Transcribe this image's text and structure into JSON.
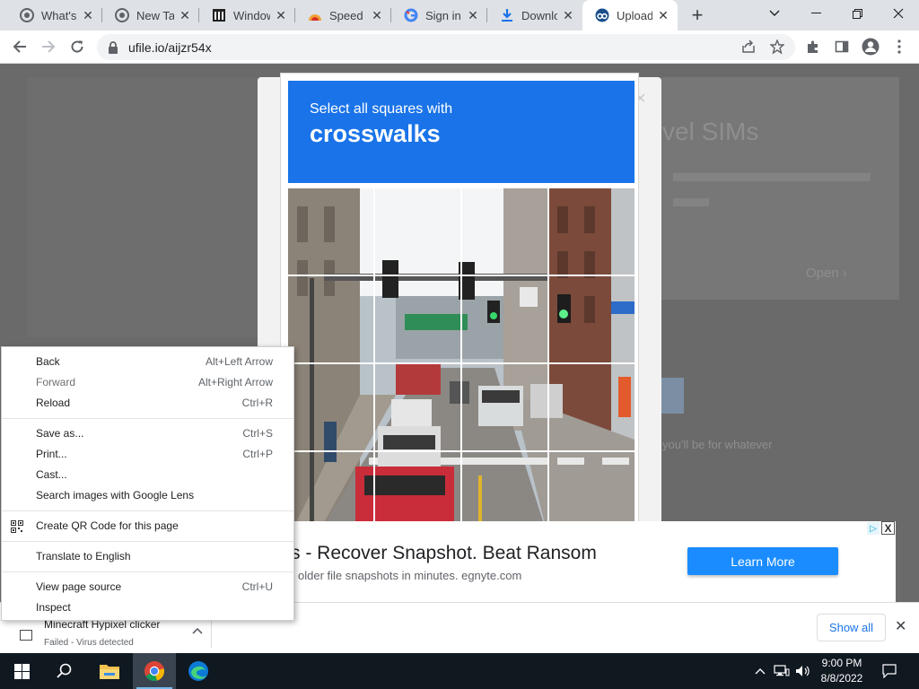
{
  "browser": {
    "tabs": [
      {
        "title": "What's N",
        "icon": "chrome-icon"
      },
      {
        "title": "New Tab",
        "icon": "chrome-icon"
      },
      {
        "title": "Windows",
        "icon": "building-icon"
      },
      {
        "title": "Speed D",
        "icon": "speed-icon"
      },
      {
        "title": "Sign in",
        "icon": "google-icon"
      },
      {
        "title": "Downlo",
        "icon": "download-icon"
      },
      {
        "title": "Upload",
        "icon": "ufile-icon",
        "active": true
      }
    ],
    "url": "ufile.io/aijzr54x"
  },
  "background": {
    "heading_fragment": "vel SIMs",
    "cta_fragment": "Open",
    "footer_fragment": "you'll be for whatever"
  },
  "captcha": {
    "instruction": "Select all squares with",
    "target": "crosswalks",
    "close": "×"
  },
  "ad": {
    "title": "s - Recover Snapshot. Beat Ransom",
    "subtitle": "older file snapshots in minutes. egnyte.com",
    "button": "Learn More",
    "info": "▷",
    "close": "X"
  },
  "download": {
    "filename": "Minecraft Hypixel clicker",
    "status": "Failed - Virus detected",
    "show_all": "Show all",
    "close": "✕"
  },
  "context_menu": {
    "groups": [
      [
        {
          "label": "Back",
          "shortcut": "Alt+Left Arrow",
          "disabled": false
        },
        {
          "label": "Forward",
          "shortcut": "Alt+Right Arrow",
          "disabled": true
        },
        {
          "label": "Reload",
          "shortcut": "Ctrl+R",
          "disabled": false
        }
      ],
      [
        {
          "label": "Save as...",
          "shortcut": "Ctrl+S",
          "disabled": false
        },
        {
          "label": "Print...",
          "shortcut": "Ctrl+P",
          "disabled": false
        },
        {
          "label": "Cast...",
          "shortcut": "",
          "disabled": false
        },
        {
          "label": "Search images with Google Lens",
          "shortcut": "",
          "disabled": false
        }
      ],
      [
        {
          "label": "Create QR Code for this page",
          "shortcut": "",
          "disabled": false,
          "icon": "qr-code-icon"
        }
      ],
      [
        {
          "label": "Translate to English",
          "shortcut": "",
          "disabled": false
        }
      ],
      [
        {
          "label": "View page source",
          "shortcut": "Ctrl+U",
          "disabled": false
        },
        {
          "label": "Inspect",
          "shortcut": "",
          "disabled": false
        }
      ]
    ]
  },
  "taskbar": {
    "time": "9:00 PM",
    "date": "8/8/2022"
  },
  "colors": {
    "accent": "#1a73e8",
    "ad_button": "#1a8cff",
    "taskbar": "#101820"
  }
}
